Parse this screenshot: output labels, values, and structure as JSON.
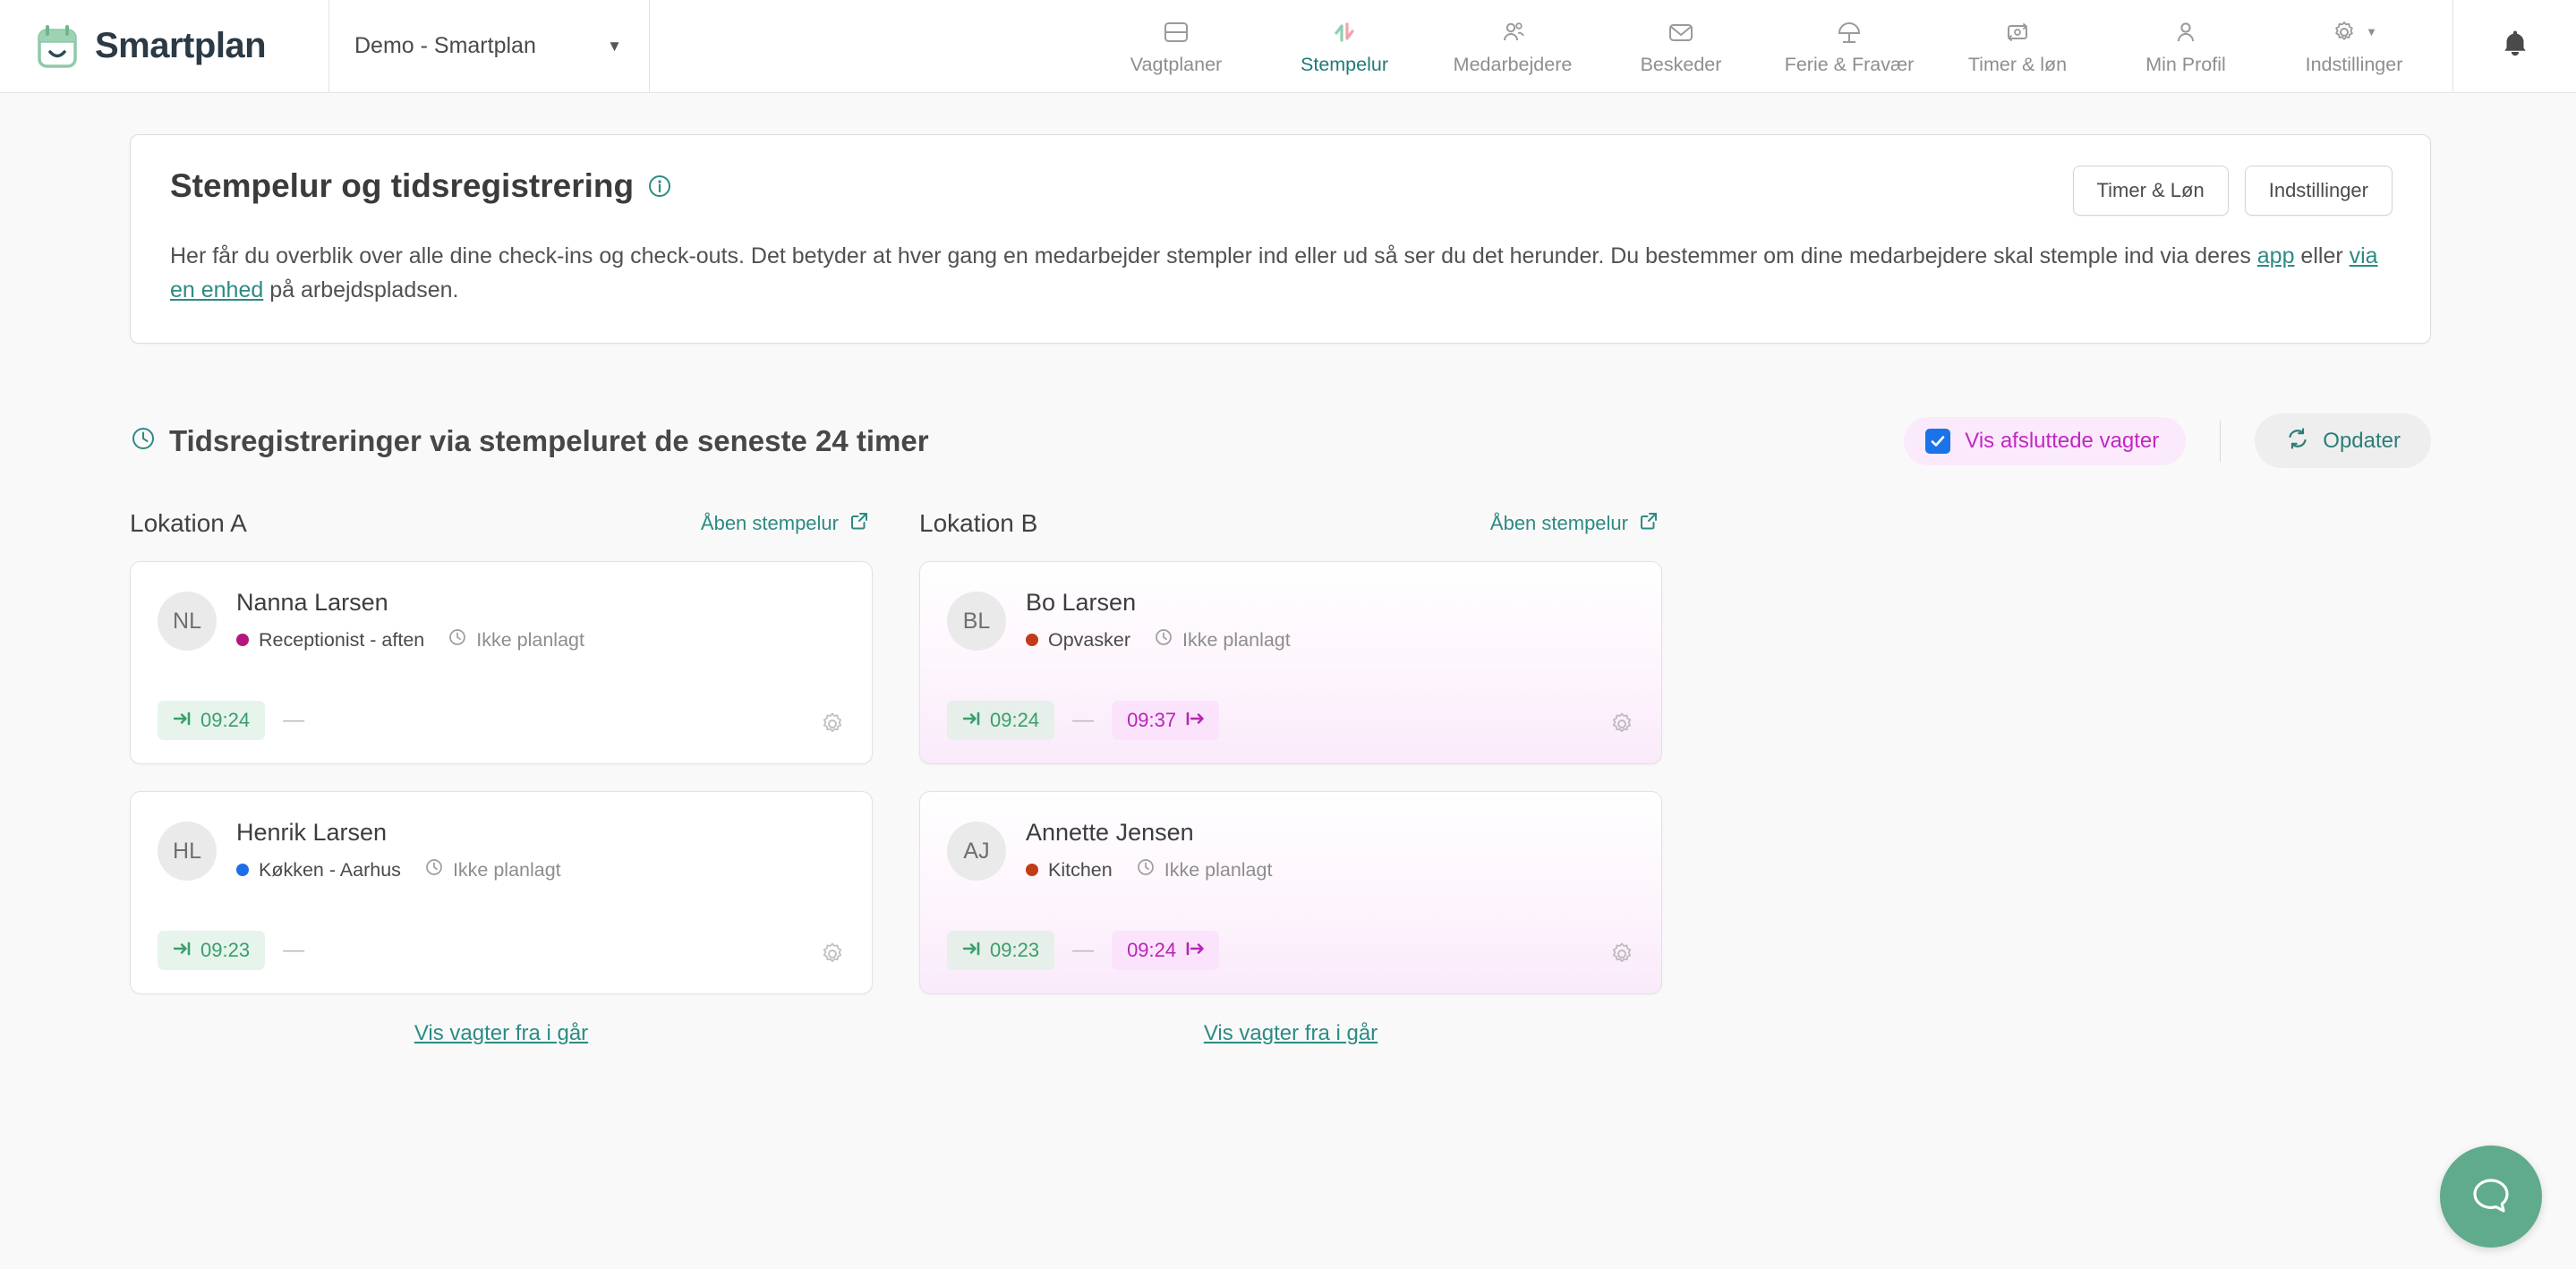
{
  "brand": {
    "name": "Smartplan",
    "logo_icon": "calendar-smile-logo"
  },
  "org_selector": {
    "value": "Demo - Smartplan",
    "caret_icon": "chevron-down-icon"
  },
  "nav": {
    "items": [
      {
        "label": "Vagtplaner",
        "icon": "schedule-icon",
        "active": false
      },
      {
        "label": "Stempelur",
        "icon": "punch-clock-arrows-icon",
        "active": true
      },
      {
        "label": "Medarbejdere",
        "icon": "people-icon",
        "active": false
      },
      {
        "label": "Beskeder",
        "icon": "envelope-icon",
        "active": false
      },
      {
        "label": "Ferie & Fravær",
        "icon": "beach-umbrella-icon",
        "active": false
      },
      {
        "label": "Timer & løn",
        "icon": "time-payroll-icon",
        "active": false
      },
      {
        "label": "Min Profil",
        "icon": "person-icon",
        "active": false
      },
      {
        "label": "Indstillinger",
        "icon": "gear-icon",
        "active": false,
        "caret": "▼"
      }
    ],
    "notifications_icon": "bell-icon"
  },
  "info_card": {
    "title": "Stempelur og tidsregistrering",
    "info_icon": "info-circle-icon",
    "buttons": [
      {
        "label": "Timer & Løn"
      },
      {
        "label": "Indstillinger"
      }
    ],
    "body": {
      "part1": "Her får du overblik over alle dine check-ins og check-outs. Det betyder at hver gang en medarbejder stempler ind eller ud så ser du det herunder. Du bestemmer om dine medarbejdere skal stemple ind via deres ",
      "link1": "app",
      "part2": " eller ",
      "link2": "via en enhed",
      "part3": " på arbejdspladsen."
    }
  },
  "section": {
    "clock_icon": "clock-icon",
    "title": "Tidsregistreringer via stempeluret de seneste 24 timer",
    "show_completed": {
      "label": "Vis afsluttede vagter",
      "checked": true,
      "check_icon": "checkmark-icon"
    },
    "refresh": {
      "label": "Opdater",
      "icon": "refresh-icon"
    }
  },
  "columns": [
    {
      "title": "Lokation A",
      "open_link": {
        "label": "Åben stempelur",
        "icon": "external-link-icon"
      },
      "footer_link": "Vis vagter fra i går",
      "entries": [
        {
          "initials": "NL",
          "name": "Nanna Larsen",
          "role": "Receptionist - aften",
          "role_color": "#b5167f",
          "plan_status": "Ikke planlagt",
          "plan_icon": "clock-icon",
          "check_in": "09:24",
          "check_in_icon": "arrow-in-icon",
          "check_out": null,
          "check_out_icon": "arrow-out-icon",
          "separator": "—",
          "gear_icon": "gear-icon",
          "completed": false
        },
        {
          "initials": "HL",
          "name": "Henrik Larsen",
          "role": "Køkken - Aarhus",
          "role_color": "#1d6ee8",
          "plan_status": "Ikke planlagt",
          "plan_icon": "clock-icon",
          "check_in": "09:23",
          "check_in_icon": "arrow-in-icon",
          "check_out": null,
          "check_out_icon": "arrow-out-icon",
          "separator": "—",
          "gear_icon": "gear-icon",
          "completed": false
        }
      ]
    },
    {
      "title": "Lokation B",
      "open_link": {
        "label": "Åben stempelur",
        "icon": "external-link-icon"
      },
      "footer_link": "Vis vagter fra i går",
      "entries": [
        {
          "initials": "BL",
          "name": "Bo Larsen",
          "role": "Opvasker",
          "role_color": "#c23b18",
          "plan_status": "Ikke planlagt",
          "plan_icon": "clock-icon",
          "check_in": "09:24",
          "check_in_icon": "arrow-in-icon",
          "check_out": "09:37",
          "check_out_icon": "arrow-out-icon",
          "separator": "—",
          "gear_icon": "gear-icon",
          "completed": true
        },
        {
          "initials": "AJ",
          "name": "Annette Jensen",
          "role": "Kitchen",
          "role_color": "#c23b18",
          "plan_status": "Ikke planlagt",
          "plan_icon": "clock-icon",
          "check_in": "09:23",
          "check_in_icon": "arrow-in-icon",
          "check_out": "09:24",
          "check_out_icon": "arrow-out-icon",
          "separator": "—",
          "gear_icon": "gear-icon",
          "completed": true
        }
      ]
    }
  ],
  "chat": {
    "icon": "chat-bubble-icon",
    "color": "#5fab8b"
  },
  "colors": {
    "teal": "#2d8a84",
    "magenta": "#c227c2",
    "green": "#3a9e6b",
    "blue": "#1a73e8",
    "page_bg": "#f9f9f9"
  }
}
